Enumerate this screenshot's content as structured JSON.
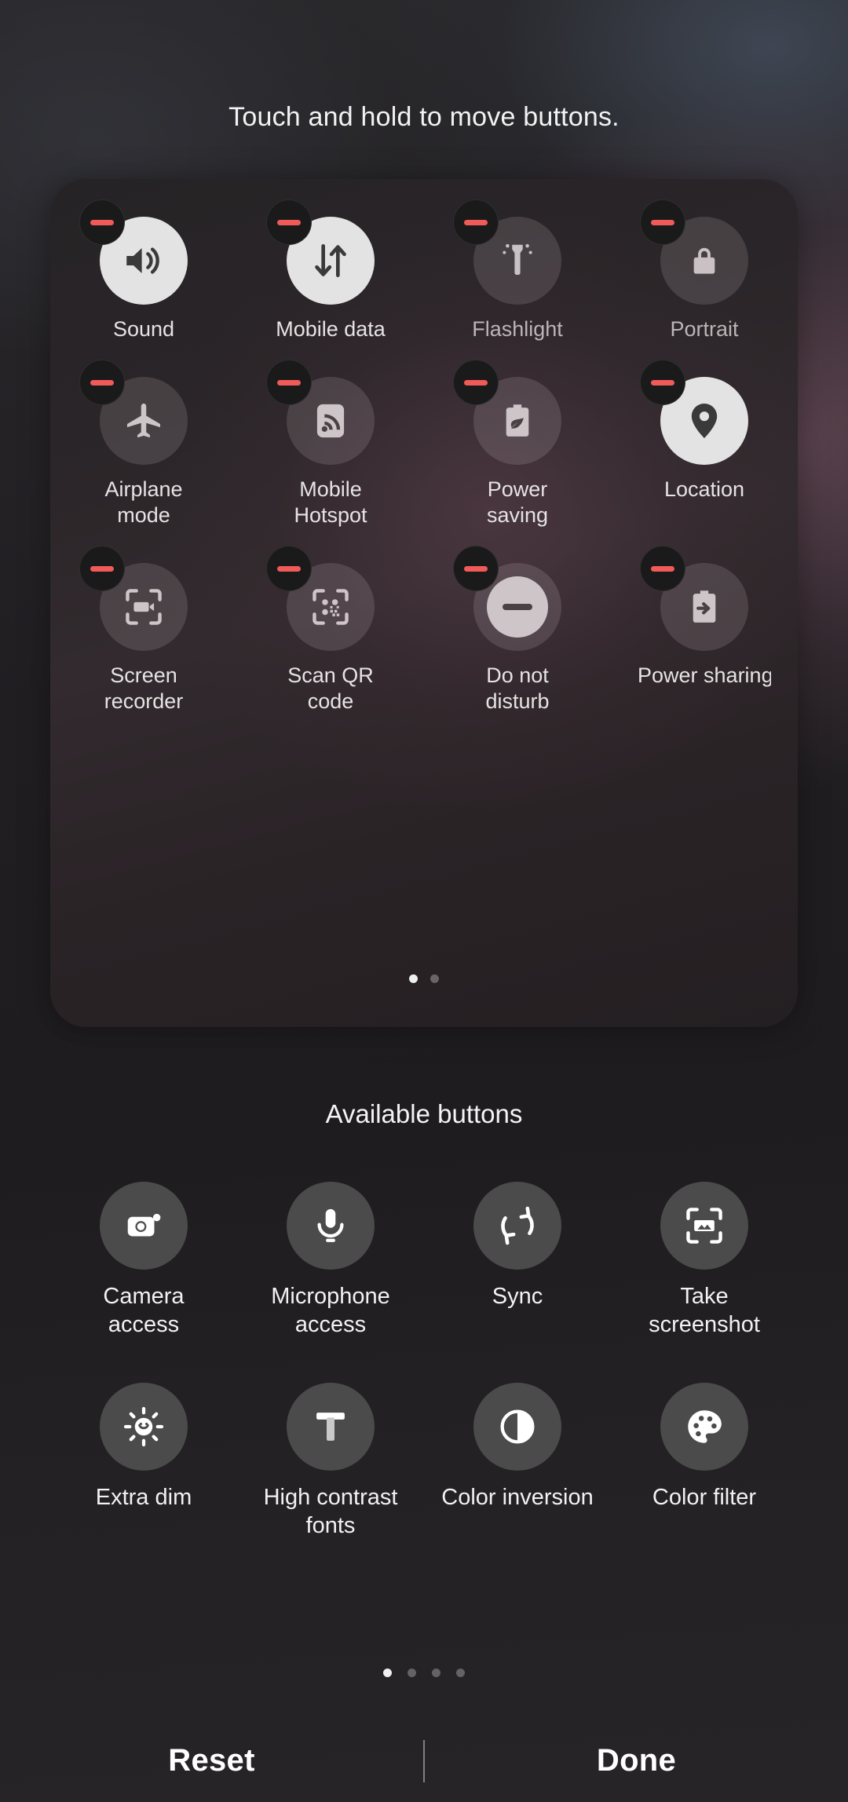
{
  "header": {
    "instruction": "Touch and hold to move buttons."
  },
  "active_panel": {
    "tiles": [
      {
        "label": "Sound",
        "icon": "sound-icon",
        "state": "on"
      },
      {
        "label": "Mobile data",
        "icon": "mobile-data-icon",
        "state": "on"
      },
      {
        "label": "Flashlight",
        "icon": "flashlight-icon",
        "state": "off"
      },
      {
        "label": "Portrait",
        "icon": "rotation-lock-icon",
        "state": "off"
      },
      {
        "label": "Airplane mode",
        "icon": "airplane-icon",
        "state": "off"
      },
      {
        "label": "Mobile Hotspot",
        "icon": "hotspot-icon",
        "state": "off"
      },
      {
        "label": "Power saving",
        "icon": "power-saving-icon",
        "state": "off"
      },
      {
        "label": "Location",
        "icon": "location-pin-icon",
        "state": "on"
      },
      {
        "label": "Screen recorder",
        "icon": "screen-recorder-icon",
        "state": "off"
      },
      {
        "label": "Scan QR code",
        "icon": "qr-scan-icon",
        "state": "off"
      },
      {
        "label": "Do not disturb",
        "icon": "do-not-disturb-icon",
        "state": "on"
      },
      {
        "label": "Power sharing",
        "icon": "power-sharing-icon",
        "state": "off"
      }
    ],
    "remove_badge_icon": "minus-icon",
    "pagination": {
      "count": 2,
      "active_index": 0
    }
  },
  "available_section": {
    "title": "Available buttons",
    "tiles": [
      {
        "label": "Camera access",
        "icon": "camera-icon"
      },
      {
        "label": "Microphone access",
        "icon": "microphone-icon"
      },
      {
        "label": "Sync",
        "icon": "sync-icon"
      },
      {
        "label": "Take screenshot",
        "icon": "screenshot-icon"
      },
      {
        "label": "Extra dim",
        "icon": "extra-dim-icon"
      },
      {
        "label": "High contrast fonts",
        "icon": "high-contrast-fonts-icon"
      },
      {
        "label": "Color inversion",
        "icon": "color-inversion-icon"
      },
      {
        "label": "Color filter",
        "icon": "color-filter-icon"
      }
    ],
    "pagination": {
      "count": 4,
      "active_index": 0
    }
  },
  "bottom_bar": {
    "reset_label": "Reset",
    "done_label": "Done"
  },
  "colors": {
    "accent_remove": "#f05a58",
    "tile_on": "#e3e3e3",
    "tile_off": "rgba(216,206,210,0.16)",
    "available_tile": "#4b4b4b",
    "text_primary": "#f2f2f2"
  }
}
